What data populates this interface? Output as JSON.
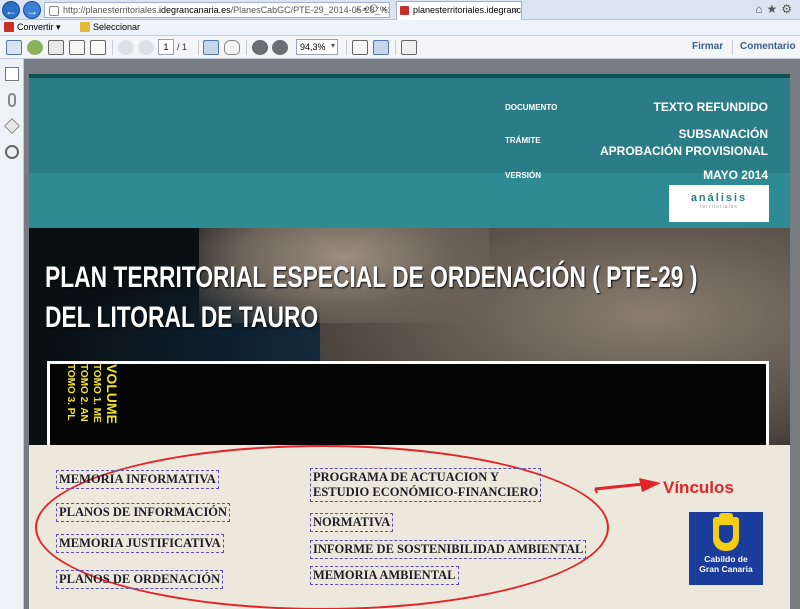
{
  "browser": {
    "url_prefix": "http://planesterritoriales.",
    "url_domain": "idegrancanaria.es",
    "url_rest": "/PlanesCabGC/PTE-29_2014-05-28_%282014-05-2",
    "addr_tools": "⌕ ▾ ⟳ ×",
    "tab_title": "planesterritoriales.idegranc...",
    "tab_close": "×",
    "win_icons": "⌂★⚙"
  },
  "command_bar": {
    "convert_label": "Convertir",
    "select_label": "Seleccionar"
  },
  "toolbar": {
    "page_current": "1",
    "page_total": "/ 1",
    "zoom": "94,3%",
    "sign_label": "Firmar",
    "comment_label": "Comentario"
  },
  "document": {
    "meta": [
      {
        "label": "DOCUMENTO",
        "value": "TEXTO REFUNDIDO"
      },
      {
        "label": "TRÁMITE",
        "value_line1": "SUBSANACIÓN",
        "value_line2": "APROBACIÓN PROVISIONAL"
      },
      {
        "label": "VERSIÓN",
        "value": "MAYO 2014"
      }
    ],
    "logo_text": "análisis",
    "logo_sub": "territoriales",
    "title_line1": "PLAN TERRITORIAL ESPECIAL DE ORDENACIÓN  ( PTE-29 )",
    "title_line2": "DEL LITORAL DE TAURO",
    "volume_lines": [
      "VOLUME",
      "TOMO 1. ME",
      "TOMO 2. AN",
      "TOMO 3. PL"
    ],
    "links_left": [
      "MEMORIA INFORMATIVA",
      "PLANOS DE INFORMACIÓN",
      "MEMORIA JUSTIFICATIVA",
      "PLANOS DE ORDENACIÓN"
    ],
    "links_right_1a": "PROGRAMA DE ACTUACION Y",
    "links_right_1b": "ESTUDIO ECONÓMICO-FINANCIERO",
    "links_right": [
      "NORMATIVA",
      "INFORME DE SOSTENIBILIDAD AMBIENTAL",
      "MEMORIA AMBIENTAL"
    ],
    "annotation": "Vínculos",
    "cabildo_line1": "Cabildo de",
    "cabildo_line2": "Gran Canaria"
  },
  "colors": {
    "teal": "#2a7d86",
    "annotation_red": "#e32428",
    "cabildo_blue": "#1a3c9a"
  }
}
